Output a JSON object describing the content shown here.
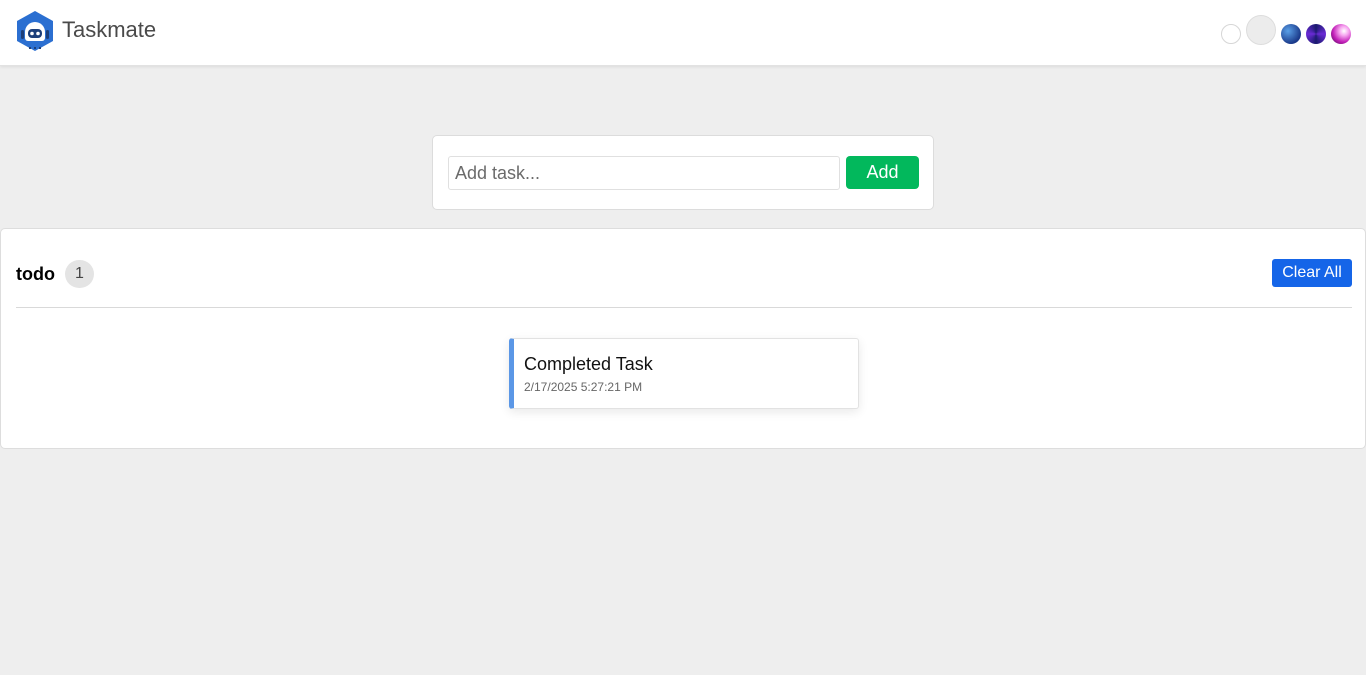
{
  "header": {
    "title": "Taskmate",
    "logo_icon": "robot-logo-icon",
    "themes": [
      {
        "name": "white-theme",
        "color": "#ffffff"
      },
      {
        "name": "light-theme",
        "color": "#ececec"
      },
      {
        "name": "blue-theme",
        "color": "#1b3a8a"
      },
      {
        "name": "purple-theme",
        "color": "#6b2bd6"
      },
      {
        "name": "pink-theme",
        "color": "#c21fb8"
      }
    ]
  },
  "add_task": {
    "placeholder": "Add task...",
    "value": "",
    "button_label": "Add",
    "button_color": "#02b85c"
  },
  "list": {
    "title": "todo",
    "count": "1",
    "clear_label": "Clear All",
    "clear_color": "#1565e8",
    "tasks": [
      {
        "title": "Completed Task",
        "timestamp": "2/17/2025 5:27:21 PM",
        "accent": "#5b97e6"
      }
    ]
  }
}
